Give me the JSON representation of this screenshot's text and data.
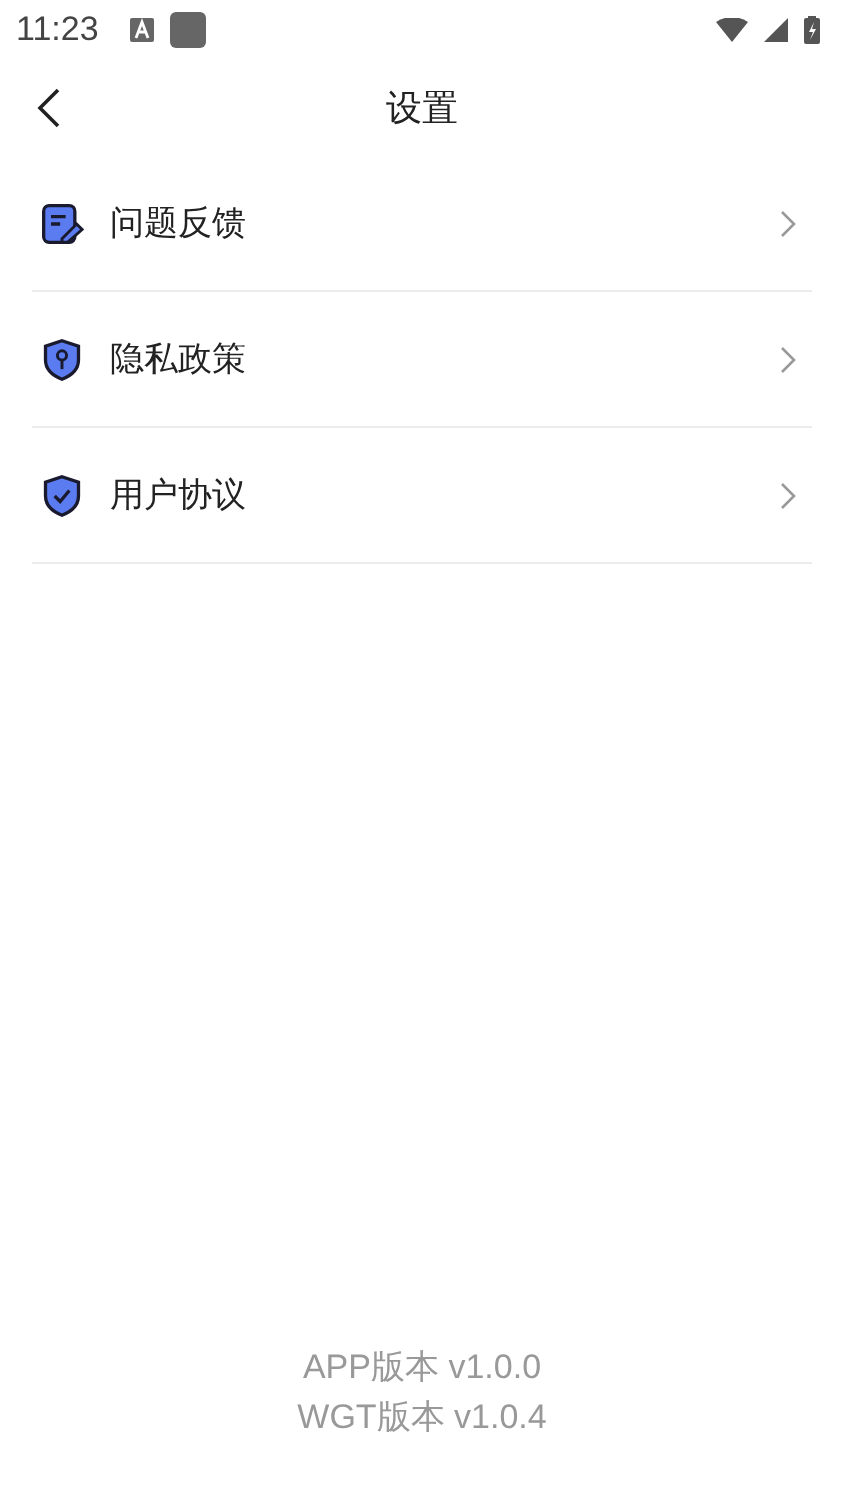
{
  "status_bar": {
    "time": "11:23"
  },
  "nav": {
    "title": "设置"
  },
  "menu": [
    {
      "kind": "feedback",
      "label": "问题反馈"
    },
    {
      "kind": "privacy",
      "label": "隐私政策"
    },
    {
      "kind": "agreement",
      "label": "用户协议"
    }
  ],
  "footer": {
    "lines": [
      "APP版本 v1.0.0",
      "WGT版本 v1.0.4"
    ]
  }
}
